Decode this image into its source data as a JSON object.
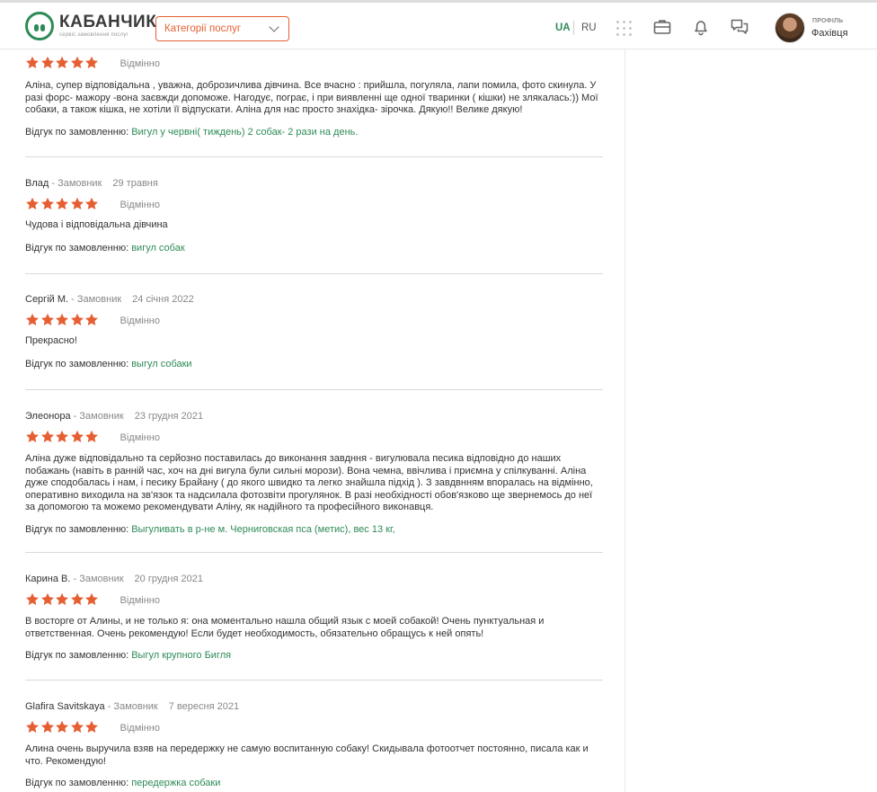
{
  "header": {
    "logo_name": "КАБАНЧИК",
    "logo_sub": "сервіс замовлення послуг",
    "category_button": "Категорії послуг",
    "lang_ua": "UA",
    "lang_ru": "RU",
    "profile_small": "ПРОФІЛЬ",
    "profile_role": "Фахівця",
    "brand_color": "#2e8b57",
    "accent_color": "#e55f33"
  },
  "reviews": [
    {
      "author": "",
      "role": "",
      "date": "",
      "stars": 5,
      "rating_label": "Відмінно",
      "text": "Аліна, супер відповідальна , уважна, доброзичлива дівчина. Все вчасно : прийшла, погуляла, лапи помила, фото скинула. У разі форс- мажору -вона заєвжди допоможе. Нагодує, пограє, і при виявленні ще одної тваринки ( кішки) не злякалась:)) Мої собаки, а також кішка, не хотіли її відпускати. Аліна для нас просто знахідка- зірочка. Дякую!! Велике дякую!",
      "order_prefix": "Відгук по замовленню:",
      "order_link": "Вигул у червні( тиждень) 2 собак- 2 рази на день."
    },
    {
      "author": "Влад",
      "role": " - Замовник",
      "date": "29 травня",
      "stars": 5,
      "rating_label": "Відмінно",
      "text": "Чудова і відповідальна дівчина",
      "order_prefix": "Відгук по замовленню:",
      "order_link": "вигул собак"
    },
    {
      "author": "Сергій М.",
      "role": " - Замовник",
      "date": "24 січня 2022",
      "stars": 5,
      "rating_label": "Відмінно",
      "text": "Прекрасно!",
      "order_prefix": "Відгук по замовленню:",
      "order_link": "выгул собаки"
    },
    {
      "author": "Элеонора",
      "role": " - Замовник",
      "date": "23 грудня 2021",
      "stars": 5,
      "rating_label": "Відмінно",
      "text": "Аліна дуже відповідально та серйозно поставилась до виконання завдння - вигулювала песика відповідно до наших побажань (навіть в ранній час, хоч на дні вигула були сильні морози). Вона чемна, ввічлива і приємна у спілкуванні. Аліна дуже сподобалась і нам, і песику Брайану ( до якого швидко та легко знайшла підхід ). З завдвнням впоралась на відмінно, оперативно виходила на зв'язок та надсилала фотозвіти прогулянок. В разі необхідності обов'язково ще звернемось до неї за допомогою та можемо рекомендувати Аліну, як надійного та професійного виконавця.",
      "order_prefix": "Відгук по замовленню:",
      "order_link": "Выгуливать в р-не м. Черниговская пса (метис), вес 13 кг,"
    },
    {
      "author": "Карина В.",
      "role": " - Замовник",
      "date": "20 грудня 2021",
      "stars": 5,
      "rating_label": "Відмінно",
      "text": "В восторге от Алины, и не только я: она моментально нашла общий язык с моей собакой! Очень пунктуальная и ответственная. Очень рекомендую! Если будет необходимость, обязательно обращусь к ней опять!",
      "order_prefix": "Відгук по замовленню:",
      "order_link": "Выгул крупного Бигля"
    },
    {
      "author": "Glafira Savitskaya",
      "role": " - Замовник",
      "date": "7 вересня 2021",
      "stars": 5,
      "rating_label": "Відмінно",
      "text": "Алина очень выручила взяв на передержку не самую воспитанную собаку! Скидывала фотоотчет постоянно, писала как и что. Рекомендую!",
      "order_prefix": "Відгук по замовленню:",
      "order_link": "передержка собаки"
    }
  ]
}
